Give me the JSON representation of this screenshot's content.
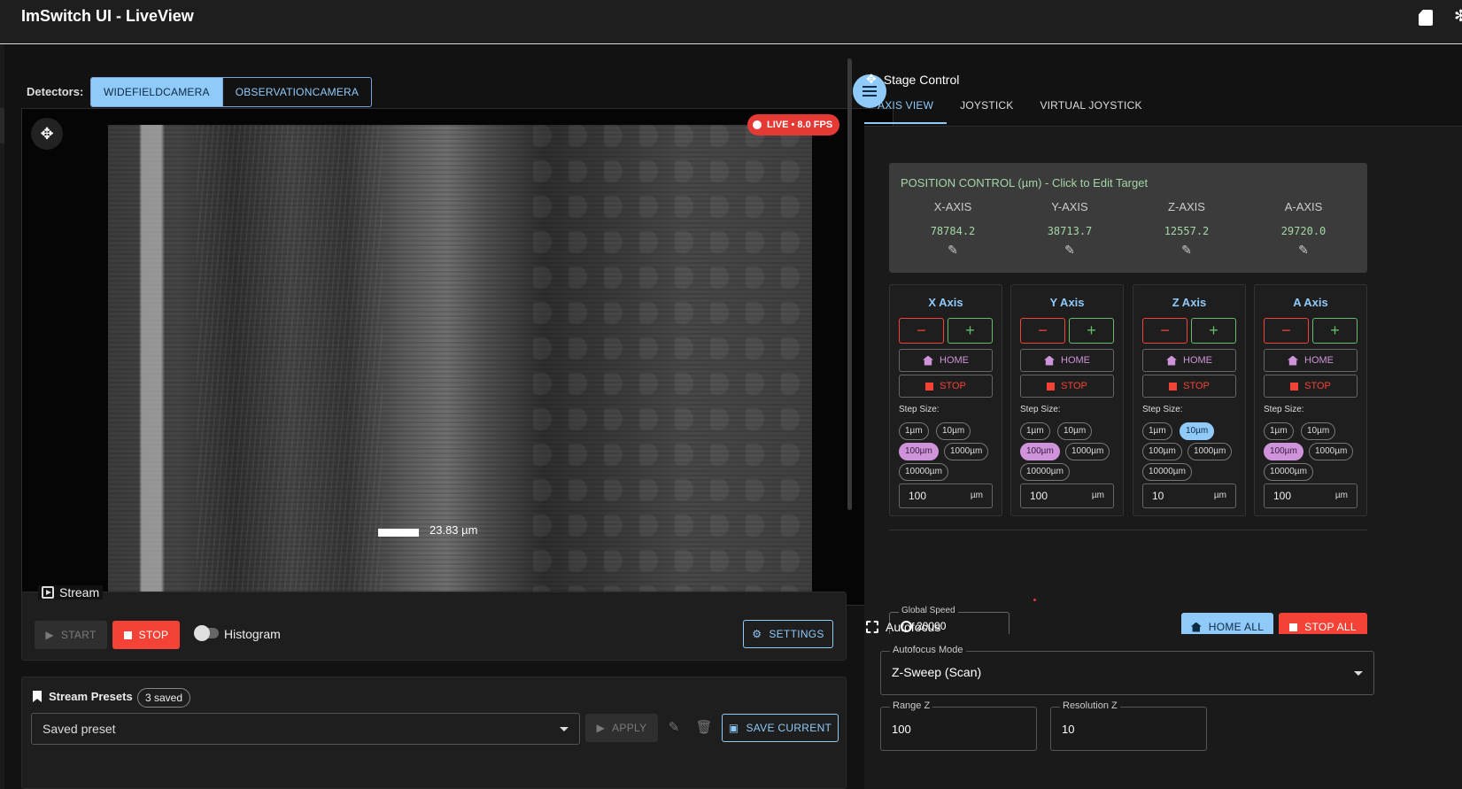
{
  "app": {
    "title": "ImSwitch UI - LiveView"
  },
  "icons": {
    "sd_card": "sd-card-icon",
    "gamepad": "gamepad-icon",
    "menu": "menu-icon",
    "move": "move-icon",
    "autofocus": "autofocus-icon"
  },
  "detectors": {
    "label": "Detectors:",
    "items": [
      {
        "label": "WIDEFIELDCAMERA",
        "active": true
      },
      {
        "label": "OBSERVATIONCAMERA",
        "active": false
      }
    ]
  },
  "viewer": {
    "live_badge": "LIVE • 8.0 FPS",
    "scale_label": "23.83 µm"
  },
  "stream": {
    "title": "Stream",
    "start_label": "START",
    "stop_label": "STOP",
    "histogram_label": "Histogram",
    "histogram_enabled": false,
    "settings_label": "SETTINGS"
  },
  "presets": {
    "title": "Stream Presets",
    "count_label": "3 saved",
    "select_value": "Saved preset",
    "apply_label": "APPLY",
    "save_label": "SAVE CURRENT"
  },
  "stage": {
    "title": "Stage Control",
    "tabs": [
      {
        "label": "AXIS VIEW",
        "active": true
      },
      {
        "label": "JOYSTICK",
        "active": false
      },
      {
        "label": "VIRTUAL JOYSTICK",
        "active": false
      }
    ],
    "position": {
      "title": "POSITION CONTROL (µm) - Click to Edit Target",
      "axes": [
        {
          "label": "X-AXIS",
          "value": "78784.2"
        },
        {
          "label": "Y-AXIS",
          "value": "38713.7"
        },
        {
          "label": "Z-AXIS",
          "value": "12557.2"
        },
        {
          "label": "A-AXIS",
          "value": "29720.0"
        }
      ]
    },
    "home_label": "HOME",
    "stop_label": "STOP",
    "step_label": "Step Size:",
    "unit": "µm",
    "axis_cards": [
      {
        "title": "X Axis",
        "step_selected": "100µm",
        "step_value": "100"
      },
      {
        "title": "Y Axis",
        "step_selected": "100µm",
        "step_value": "100"
      },
      {
        "title": "Z Axis",
        "step_selected": "10µm",
        "step_value": "10"
      },
      {
        "title": "A Axis",
        "step_selected": "100µm",
        "step_value": "100"
      }
    ],
    "step_options": [
      "1µm",
      "10µm",
      "100µm",
      "1000µm",
      "10000µm"
    ],
    "global_speed": {
      "label": "Global Speed",
      "value": "20000"
    },
    "home_all_label": "HOME ALL",
    "stop_all_label": "STOP ALL"
  },
  "autofocus": {
    "title": "Autofocus",
    "mode": {
      "label": "Autofocus Mode",
      "value": "Z-Sweep (Scan)"
    },
    "range_z": {
      "label": "Range Z",
      "value": "100"
    },
    "resolution_z": {
      "label": "Resolution Z",
      "value": "10"
    }
  },
  "colors": {
    "accent": "#90caf9",
    "danger": "#f44336",
    "success": "#66bb6a",
    "purple": "#ce93d8",
    "position_text": "#a5d6a7"
  }
}
